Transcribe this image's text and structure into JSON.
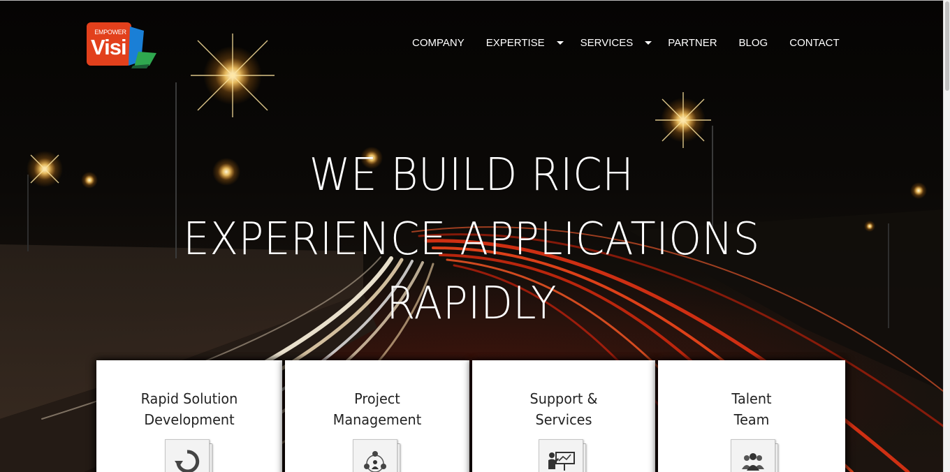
{
  "logo": {
    "top_text": "EMPOWER",
    "main_text": "Visi"
  },
  "nav": {
    "items": [
      {
        "label": "COMPANY"
      },
      {
        "label": "EXPERTISE"
      },
      {
        "label": "SERVICES"
      },
      {
        "label": "PARTNER"
      },
      {
        "label": "BLOG"
      },
      {
        "label": "CONTACT"
      }
    ],
    "dropdown_items": [
      "EXPERTISE",
      "SERVICES"
    ]
  },
  "hero": {
    "headline_lines": [
      "WE BUILD RICH",
      "EXPERIENCE APPLICATIONS",
      "RAPIDLY"
    ],
    "background": "night highway light trails"
  },
  "cards": [
    {
      "title_lines": [
        "Rapid Solution",
        "Development"
      ],
      "icon": "refresh-icon"
    },
    {
      "title_lines": [
        "Project",
        "Management"
      ],
      "icon": "team-network-icon"
    },
    {
      "title_lines": [
        "Support &",
        "Services"
      ],
      "icon": "presentation-icon"
    },
    {
      "title_lines": [
        "Talent",
        "Team"
      ],
      "icon": "people-group-icon"
    }
  ],
  "colors": {
    "logo_red": "#e2401c",
    "logo_blue": "#1a7fd6",
    "logo_green": "#2fa84f",
    "nav_text": "#ffffff",
    "card_bg": "#ffffff"
  }
}
